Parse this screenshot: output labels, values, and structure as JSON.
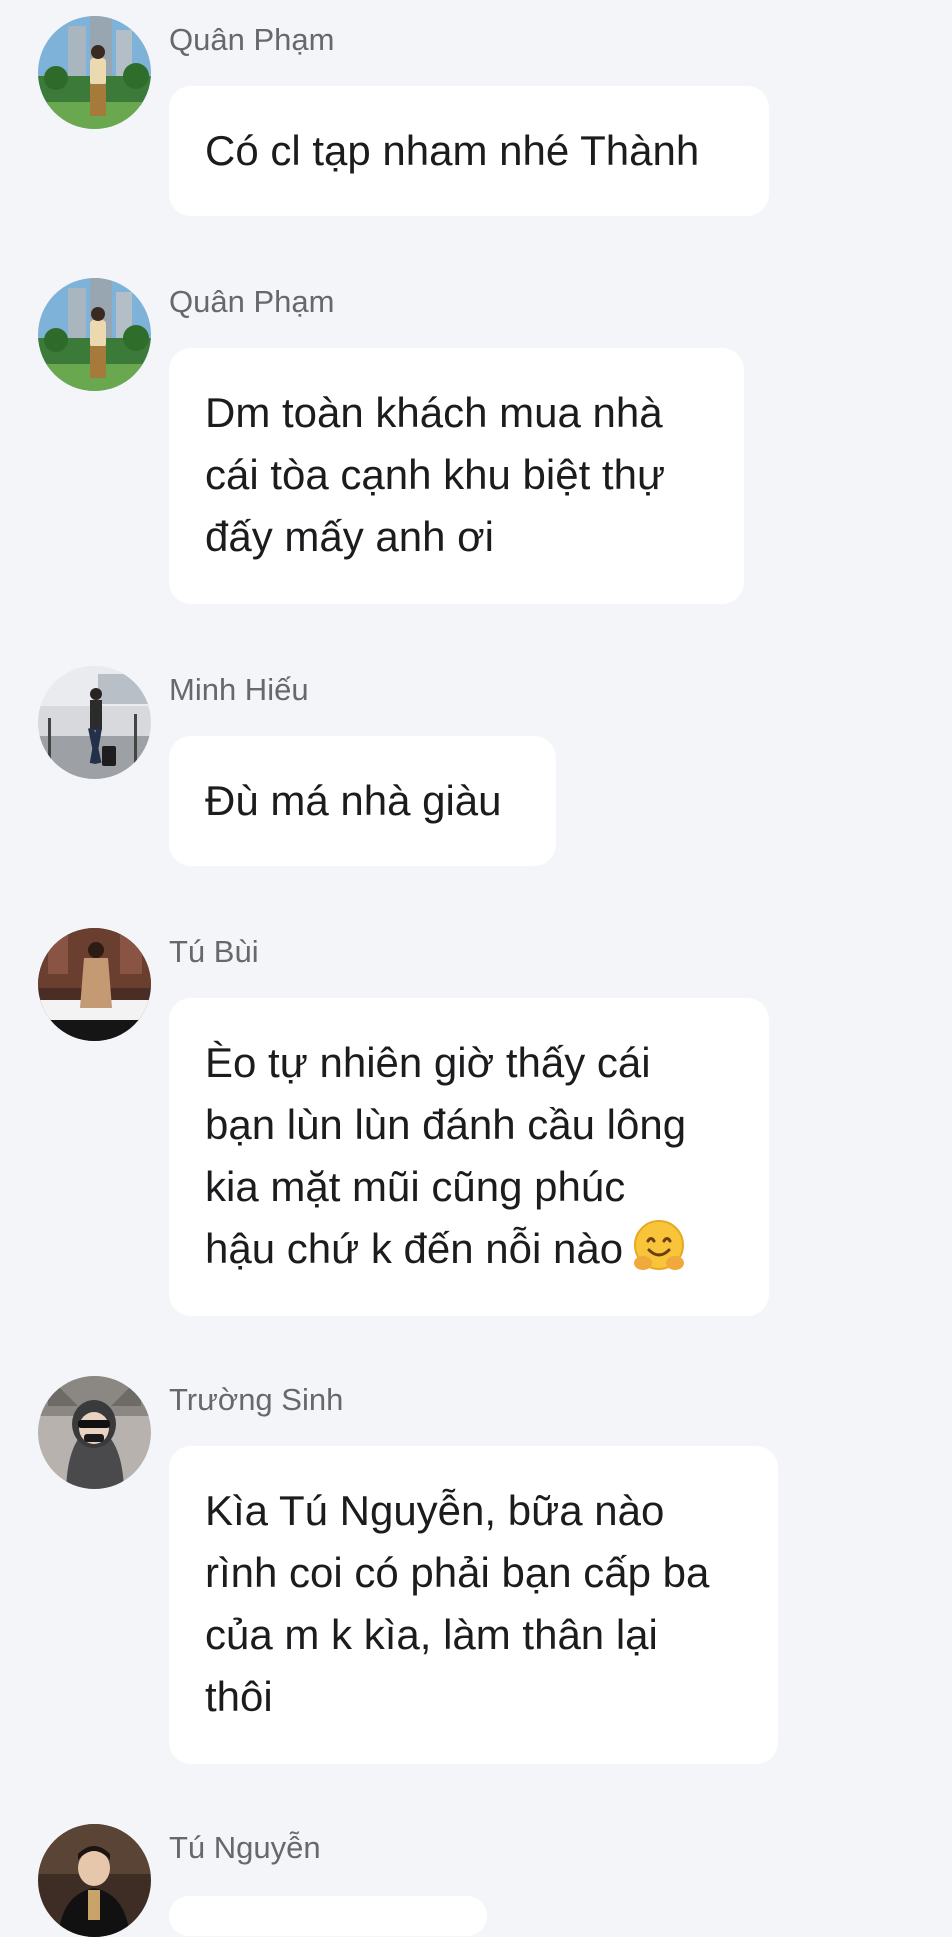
{
  "messages": [
    {
      "sender": "Quân Phạm",
      "lines": [
        "Có cl tạp nham nhé Thành"
      ],
      "avatar_icon": "user-avatar-quan-pham"
    },
    {
      "sender": "Quân Phạm",
      "lines": [
        "Dm toàn khách mua nhà",
        "cái tòa cạnh khu biệt thự",
        "đấy mấy anh ơi"
      ],
      "avatar_icon": "user-avatar-quan-pham"
    },
    {
      "sender": "Minh Hiếu",
      "lines": [
        "Đù má nhà giàu"
      ],
      "avatar_icon": "user-avatar-minh-hieu"
    },
    {
      "sender": "Tú Bùi",
      "lines": [
        "Èo tự nhiên giờ thấy cái",
        "bạn lùn lùn đánh cầu lông",
        "kia mặt mũi cũng phúc",
        "hậu chứ k đến nỗi nào"
      ],
      "emoji": "hugging-face-emoji",
      "avatar_icon": "user-avatar-tu-bui"
    },
    {
      "sender": "Trường Sinh",
      "lines": [
        "Kìa Tú Nguyễn, bữa nào",
        "rình coi có phải bạn cấp ba",
        "của m k kìa, làm thân lại",
        "thôi"
      ],
      "avatar_icon": "user-avatar-truong-sinh"
    },
    {
      "sender": "Tú Nguyễn",
      "lines": [],
      "avatar_icon": "user-avatar-tu-nguyen"
    }
  ]
}
